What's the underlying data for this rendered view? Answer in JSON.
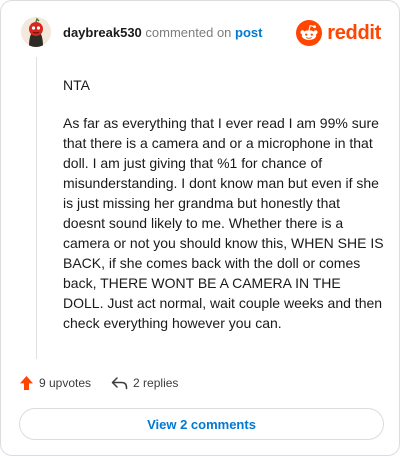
{
  "header": {
    "username": "daybreak530",
    "action_text": "commented on",
    "link_text": "post",
    "brand": "reddit"
  },
  "comment": {
    "paragraphs": [
      "NTA",
      "As far as everything that I ever read I am 99% sure that there is a camera and or a microphone in that doll. I am just giving that %1 for chance of misunderstanding. I dont know man but even if she is just missing her grandma but honestly that doesnt sound likely to me. Whether there is a camera or not you should know this, WHEN SHE IS BACK, if she comes back with the doll or comes back, THERE WONT BE A CAMERA IN THE DOLL. Just act normal, wait couple weeks and then check everything however you can."
    ]
  },
  "footer": {
    "upvotes": "9 upvotes",
    "replies": "2 replies",
    "view_button": "View 2 comments"
  },
  "icons": {
    "avatar": "avatar",
    "brand": "reddit-alien-icon",
    "upvote": "upvote-arrow-icon",
    "reply": "reply-arrow-icon"
  },
  "colors": {
    "brand": "#ff4500",
    "link": "#0079d3",
    "muted": "#7c7c7c",
    "text": "#1a1a1b"
  }
}
